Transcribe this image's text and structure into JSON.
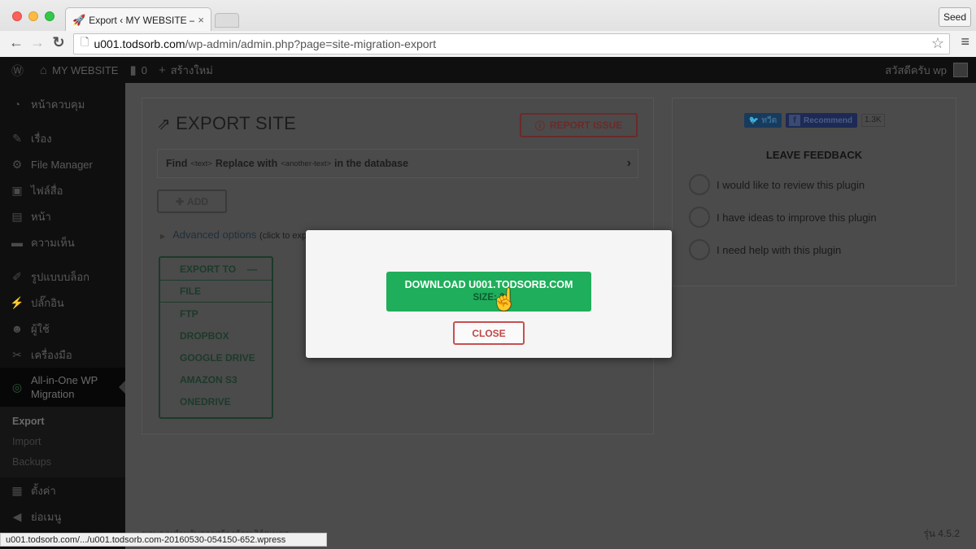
{
  "browser": {
    "tab_title": "Export ‹ MY WEBSITE — ",
    "tab_favicon": "rocket-icon",
    "profile_button": "Seed",
    "url_host": "u001.todsorb.com",
    "url_path": "/wp-admin/admin.php?page=site-migration-export",
    "status_url": "u001.todsorb.com/.../u001.todsorb.com-20160530-054150-652.wpress"
  },
  "adminbar": {
    "site_name": "MY WEBSITE",
    "comments_count": "0",
    "new_label": "สร้างใหม่",
    "greeting": "สวัสดีครับ wp"
  },
  "sidebar": {
    "items": [
      {
        "label": "หน้าควบคุม",
        "icon": "dashboard-icon"
      },
      {
        "label": "เรื่อง",
        "icon": "pin-icon"
      },
      {
        "label": "File Manager",
        "icon": "gear-icon"
      },
      {
        "label": "ไฟล์สื่อ",
        "icon": "media-icon"
      },
      {
        "label": "หน้า",
        "icon": "pages-icon"
      },
      {
        "label": "ความเห็น",
        "icon": "comment-icon"
      },
      {
        "label": "รูปแบบบล็อก",
        "icon": "brush-icon"
      },
      {
        "label": "ปลั๊กอิน",
        "icon": "plugin-icon"
      },
      {
        "label": "ผู้ใช้",
        "icon": "user-icon"
      },
      {
        "label": "เครื่องมือ",
        "icon": "wrench-icon"
      }
    ],
    "active": {
      "label": "All-in-One WP Migration",
      "icon": "migration-icon"
    },
    "submenu": [
      "Export",
      "Import",
      "Backups"
    ],
    "bottom": [
      {
        "label": "ตั้งค่า",
        "icon": "settings-icon"
      },
      {
        "label": "ย่อเมนู",
        "icon": "collapse-icon"
      }
    ]
  },
  "export": {
    "title": "EXPORT SITE",
    "report_issue": "REPORT ISSUE",
    "find_label": "Find",
    "find_text": "<text>",
    "replace_label": "Replace with",
    "replace_text": "<another-text>",
    "in_db": "in the database",
    "add_label": "ADD",
    "advanced": "Advanced options",
    "advanced_hint": "(click to expand)",
    "export_to": "EXPORT TO",
    "options": [
      "FILE",
      "FTP",
      "DROPBOX",
      "GOOGLE DRIVE",
      "AMAZON S3",
      "ONEDRIVE"
    ]
  },
  "feedback": {
    "tweet": "ทวีต",
    "recommend": "Recommend",
    "recommend_count": "1.3K",
    "title": "LEAVE FEEDBACK",
    "options": [
      "I would like to review this plugin",
      "I have ideas to improve this plugin",
      "I need help with this plugin"
    ]
  },
  "footer": {
    "thanks": "ขอบคุณสำหรับการสร้างด้วยเวิร์ดเพรส",
    "version": "รุ่น 4.5.2"
  },
  "modal": {
    "download_label": "DOWNLOAD U001.TODSORB.COM",
    "size_label": "SIZE: 3",
    "close_label": "CLOSE"
  },
  "colors": {
    "download_green": "#1fae5b",
    "close_red": "#c75050"
  }
}
